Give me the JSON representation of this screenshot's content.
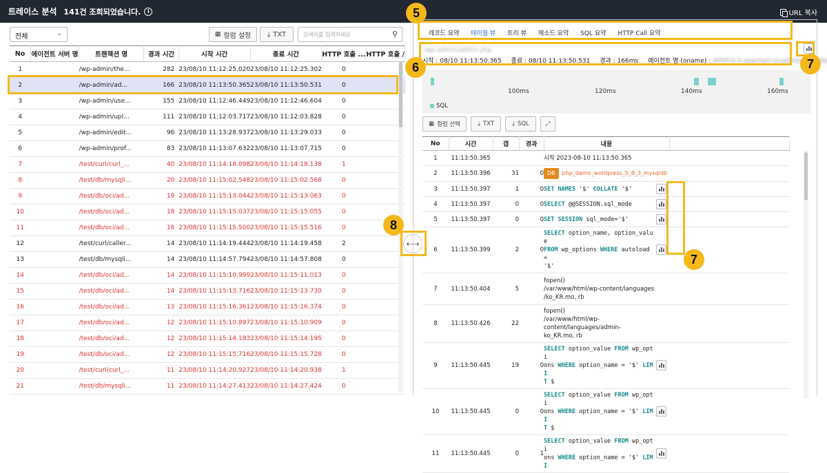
{
  "header": {
    "title": "트레이스 분석",
    "count_text": "141건 조회되었습니다.",
    "url_copy": "URL 복사"
  },
  "left": {
    "filter_value": "전체",
    "column_setting_label": "컬럼 설정",
    "txt_label": "TXT",
    "search_placeholder": "검색어를 입력하세요",
    "columns": [
      "No",
      "에이전트 서버 명",
      "트랜잭션 명",
      "경과 시간",
      "시작 시간",
      "종료 시간",
      "HTTP 호출 ...",
      "HTTP 호출 /"
    ],
    "rows": [
      {
        "no": "1",
        "server": "",
        "name": "/wp-admin/the...",
        "elapsed": "282",
        "start": "23/08/10 11:12:25.020",
        "end": "23/08/10 11:12:25.302",
        "http": "0",
        "red": false,
        "sel": false
      },
      {
        "no": "2",
        "server": "",
        "name": "/wp-admin/ad...",
        "elapsed": "166",
        "start": "23/08/10 11:13:50.365",
        "end": "23/08/10 11:13:50.531",
        "http": "0",
        "red": false,
        "sel": true
      },
      {
        "no": "3",
        "server": "",
        "name": "/wp-admin/use...",
        "elapsed": "155",
        "start": "23/08/10 11:12:46.449",
        "end": "23/08/10 11:12:46.604",
        "http": "0",
        "red": false,
        "sel": false
      },
      {
        "no": "4",
        "server": "",
        "name": "/wp-admin/upl...",
        "elapsed": "111",
        "start": "23/08/10 11:12:03.717",
        "end": "23/08/10 11:12:03.828",
        "http": "0",
        "red": false,
        "sel": false
      },
      {
        "no": "5",
        "server": "",
        "name": "/wp-admin/edit...",
        "elapsed": "96",
        "start": "23/08/10 11:13:28.937",
        "end": "23/08/10 11:13:29.033",
        "http": "0",
        "red": false,
        "sel": false
      },
      {
        "no": "6",
        "server": "",
        "name": "/wp-admin/prof...",
        "elapsed": "83",
        "start": "23/08/10 11:13:07.632",
        "end": "23/08/10 11:13:07.715",
        "http": "0",
        "red": false,
        "sel": false
      },
      {
        "no": "7",
        "server": "",
        "name": "/test/curl/curl_...",
        "elapsed": "40",
        "start": "23/08/10 11:14:18.098",
        "end": "23/08/10 11:14:18.138",
        "http": "1",
        "red": true,
        "sel": false
      },
      {
        "no": "8",
        "server": "",
        "name": "/test/db/mysqli...",
        "elapsed": "20",
        "start": "23/08/10 11:15:02.548",
        "end": "23/08/10 11:15:02.568",
        "http": "0",
        "red": true,
        "sel": false
      },
      {
        "no": "9",
        "server": "",
        "name": "/test/db/oci/ad...",
        "elapsed": "19",
        "start": "23/08/10 11:15:13.044",
        "end": "23/08/10 11:15:13.063",
        "http": "0",
        "red": true,
        "sel": false
      },
      {
        "no": "10",
        "server": "",
        "name": "/test/db/oci/ad...",
        "elapsed": "18",
        "start": "23/08/10 11:15:15.037",
        "end": "23/08/10 11:15:15.055",
        "http": "0",
        "red": true,
        "sel": false
      },
      {
        "no": "11",
        "server": "",
        "name": "/test/db/oci/ad...",
        "elapsed": "16",
        "start": "23/08/10 11:15:15.500",
        "end": "23/08/10 11:15:15.516",
        "http": "0",
        "red": true,
        "sel": false
      },
      {
        "no": "12",
        "server": "",
        "name": "/test/curl/caller...",
        "elapsed": "14",
        "start": "23/08/10 11:14:19.444",
        "end": "23/08/10 11:14:19.458",
        "http": "2",
        "red": false,
        "sel": false
      },
      {
        "no": "13",
        "server": "",
        "name": "/test/db/mysqli...",
        "elapsed": "14",
        "start": "23/08/10 11:14:57.794",
        "end": "23/08/10 11:14:57.808",
        "http": "0",
        "red": false,
        "sel": false
      },
      {
        "no": "14",
        "server": "",
        "name": "/test/db/oci/ad...",
        "elapsed": "14",
        "start": "23/08/10 11:15:10.999",
        "end": "23/08/10 11:15:11.013",
        "http": "0",
        "red": true,
        "sel": false
      },
      {
        "no": "15",
        "server": "",
        "name": "/test/db/oci/ad...",
        "elapsed": "14",
        "start": "23/08/10 11:15:13.716",
        "end": "23/08/10 11:15:13.730",
        "http": "0",
        "red": true,
        "sel": false
      },
      {
        "no": "16",
        "server": "",
        "name": "/test/db/oci/ad...",
        "elapsed": "13",
        "start": "23/08/10 11:15:16.361",
        "end": "23/08/10 11:15:16.374",
        "http": "0",
        "red": true,
        "sel": false
      },
      {
        "no": "17",
        "server": "",
        "name": "/test/db/oci/ad...",
        "elapsed": "12",
        "start": "23/08/10 11:15:10.897",
        "end": "23/08/10 11:15:10.909",
        "http": "0",
        "red": true,
        "sel": false
      },
      {
        "no": "18",
        "server": "",
        "name": "/test/db/oci/ad...",
        "elapsed": "12",
        "start": "23/08/10 11:15:14.183",
        "end": "23/08/10 11:15:14.195",
        "http": "0",
        "red": true,
        "sel": false
      },
      {
        "no": "19",
        "server": "",
        "name": "/test/db/oci/ad...",
        "elapsed": "12",
        "start": "23/08/10 11:15:15.716",
        "end": "23/08/10 11:15:15.728",
        "http": "0",
        "red": true,
        "sel": false
      },
      {
        "no": "20",
        "server": "",
        "name": "/test/curl/curl_...",
        "elapsed": "11",
        "start": "23/08/10 11:14:20.927",
        "end": "23/08/10 11:14:20.938",
        "http": "1",
        "red": true,
        "sel": false
      },
      {
        "no": "21",
        "server": "",
        "name": "/test/db/mysqli...",
        "elapsed": "11",
        "start": "23/08/10 11:14:27.413",
        "end": "23/08/10 11:14:27.424",
        "http": "0",
        "red": true,
        "sel": false
      }
    ]
  },
  "right": {
    "tabs": [
      {
        "label": "레코드 요약",
        "active": false
      },
      {
        "label": "테이블 뷰",
        "active": true
      },
      {
        "label": "트리 뷰",
        "active": false
      },
      {
        "label": "메소드 요약",
        "active": false
      },
      {
        "label": "SQL 요약",
        "active": false
      },
      {
        "label": "HTTP Call 요약",
        "active": false
      }
    ],
    "tx_title": "/wp-admin/admin.php",
    "start_label": "시작 :",
    "start_value": "08/10 11:13:50.365",
    "end_label": "종료 :",
    "end_value": "08/10 11:13:50.531",
    "elapsed_label": "경과 :",
    "elapsed_value": "166ms",
    "agent_label": "에이전트 명 (oname) :",
    "agent_value": "APHP-0-5-apache2-x1sp0041-abcd9e",
    "timeline_ticks": [
      "100ms",
      "120ms",
      "140ms",
      "160ms"
    ],
    "legend_label": "SQL",
    "btn_column": "컬럼 선택",
    "btn_txt": "TXT",
    "btn_sql": "SQL",
    "columns": [
      "No",
      "시간",
      "갭",
      "경과",
      "내용"
    ],
    "rows": [
      {
        "no": "1",
        "time": "11:13:50.365",
        "gap": "",
        "elapsed": "",
        "type": "text",
        "content": "시작  2023-08-10 11:13:50.365",
        "chart": false
      },
      {
        "no": "2",
        "time": "11:13:50.396",
        "gap": "31",
        "elapsed": "0",
        "type": "db",
        "tag": "DB",
        "content": "php_demo_wordpress_5_8_3_mysqldb",
        "chart": false
      },
      {
        "no": "3",
        "time": "11:13:50.397",
        "gap": "1",
        "elapsed": "0",
        "type": "sql",
        "content": "<span class=\"kw\">SET NAMES</span> '$' <span class=\"kw\">COLLATE</span> '$'",
        "chart": true
      },
      {
        "no": "4",
        "time": "11:13:50.397",
        "gap": "0",
        "elapsed": "0",
        "type": "sql",
        "content": "<span class=\"kw\">SELECT</span> @@SESSION.sql_mode",
        "chart": true
      },
      {
        "no": "5",
        "time": "11:13:50.397",
        "gap": "0",
        "elapsed": "0",
        "type": "sql",
        "content": "<span class=\"kw\">SET SESSION</span> sql_mode='$'",
        "chart": true
      },
      {
        "no": "6",
        "time": "11:13:50.399",
        "gap": "2",
        "elapsed": "0",
        "type": "sql",
        "content": "<span class=\"kw\">SELECT</span> option_name, option_value\n<span class=\"kw\">FROM</span> wp_options <span class=\"kw\">WHERE</span> autoload =\n'$'",
        "chart": true
      },
      {
        "no": "7",
        "time": "11:13:50.404",
        "gap": "5",
        "elapsed": "",
        "type": "text",
        "content": "fopen()\n/var/www/html/wp-content/languages\n/ko_KR.mo, rb",
        "chart": false
      },
      {
        "no": "8",
        "time": "11:13:50.426",
        "gap": "22",
        "elapsed": "",
        "type": "text",
        "content": "fopen()\n/var/www/html/wp-content/languages/admin-\nko_KR.mo, rb",
        "chart": false
      },
      {
        "no": "9",
        "time": "11:13:50.445",
        "gap": "19",
        "elapsed": "0",
        "type": "sql",
        "content": "<span class=\"kw\">SELECT</span> option_value <span class=\"kw\">FROM</span> wp_opti\nons <span class=\"kw\">WHERE</span> option_name = '$' <span class=\"kw\">LIMI</span>\n<span class=\"kw\">T</span> $",
        "chart": true
      },
      {
        "no": "10",
        "time": "11:13:50.445",
        "gap": "0",
        "elapsed": "0",
        "type": "sql",
        "content": "<span class=\"kw\">SELECT</span> option_value <span class=\"kw\">FROM</span> wp_opti\nons <span class=\"kw\">WHERE</span> option_name = '$' <span class=\"kw\">LIMI</span>\n<span class=\"kw\">T</span> $",
        "chart": true
      },
      {
        "no": "11",
        "time": "11:13:50.445",
        "gap": "0",
        "elapsed": "1",
        "type": "sql",
        "content": "<span class=\"kw\">SELECT</span> option_value <span class=\"kw\">FROM</span> wp_opti\nons <span class=\"kw\">WHERE</span> option_name = '$' <span class=\"kw\">LIMI</span>",
        "chart": true
      }
    ]
  },
  "badges": {
    "b5": "5",
    "b6": "6",
    "b7": "7",
    "b8": "8"
  },
  "colors": {
    "accent": "#f2b81e",
    "error": "#e03030",
    "selected_row": "#dfe3f5",
    "sql_bar": "#7dd0cc",
    "header_bg": "#222831"
  }
}
